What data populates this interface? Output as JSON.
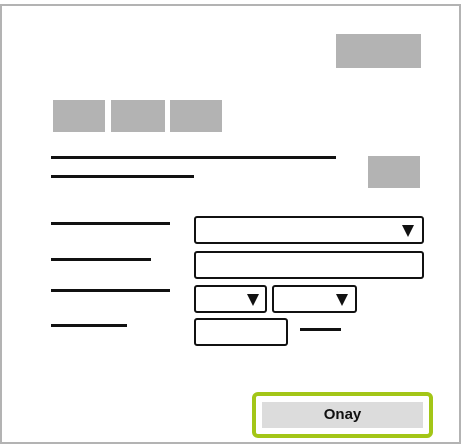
{
  "form": {
    "confirm_label": "Onay"
  }
}
